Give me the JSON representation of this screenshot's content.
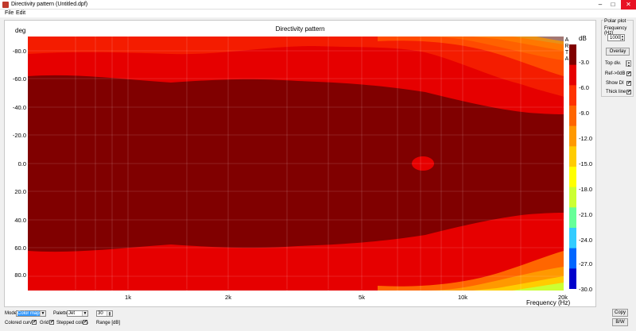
{
  "window": {
    "title": "Directivity pattern (Untitled.dpf)",
    "minimize": "–",
    "maximize": "□",
    "close": "✕"
  },
  "menu": {
    "file": "File",
    "edit": "Edit"
  },
  "plot": {
    "title": "Directivity pattern",
    "y_axis_label": "deg",
    "x_axis_label": "Frequency (Hz)",
    "y_ticks": [
      "-80.0",
      "-60.0",
      "-40.0",
      "-20.0",
      "0.0",
      "20.0",
      "40.0",
      "60.0",
      "80.0"
    ],
    "x_ticks": [
      "1k",
      "2k",
      "5k",
      "10k",
      "20k"
    ],
    "colorbar_label": "dB",
    "colorbar_ticks": [
      "-3.0",
      "-6.0",
      "-9.0",
      "-12.0",
      "-15.0",
      "-18.0",
      "-21.0",
      "-24.0",
      "-27.0",
      "-30.0"
    ],
    "colorbar_colors": [
      "#800000",
      "#e60000",
      "#ff3300",
      "#ff6600",
      "#ff9900",
      "#ffcc00",
      "#ffff00",
      "#ccff33",
      "#66ff99",
      "#33ccff",
      "#0066ff",
      "#0000cc"
    ],
    "watermark": [
      "A",
      "R",
      "T",
      "A"
    ]
  },
  "polar_plot": {
    "group_title": "Polar plot",
    "frequency_label": "Frequency (Hz)",
    "frequency_value": "1000",
    "overlay_button": "Overlay",
    "top_div_label": "Top div.",
    "ref_label": "Ref->0dB",
    "ref_checked": true,
    "show_label": "Show DI",
    "show_checked": true,
    "thick_label": "Thick line",
    "thick_checked": true
  },
  "controls": {
    "mode_label": "Mode",
    "mode_value": "Color map",
    "palette_label": "Palette",
    "palette_value": "Jet",
    "range_value": "30",
    "range_label": "Range [dB]",
    "colored_curves_label": "Colored curves",
    "colored_curves_checked": true,
    "grid_label": "Grid",
    "grid_checked": true,
    "stepped_colors_label": "Stepped colors",
    "stepped_colors_checked": true,
    "copy_button": "Copy",
    "bw_button": "B/W"
  }
}
